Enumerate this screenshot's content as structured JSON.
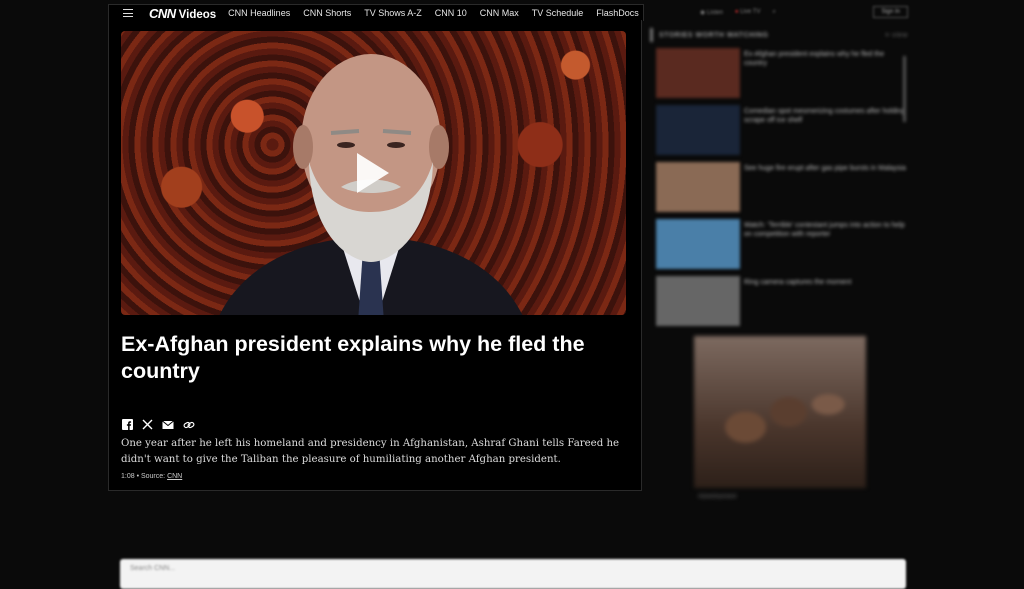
{
  "nav": {
    "logo": "CNN",
    "section": "Videos",
    "links": [
      "CNN Headlines",
      "CNN Shorts",
      "TV Shows A-Z",
      "CNN 10",
      "CNN Max",
      "TV Schedule",
      "FlashDocs"
    ],
    "right": {
      "listen": "Listen",
      "live_tv": "Live TV",
      "sign_in": "Sign In"
    }
  },
  "video": {
    "headline": "Ex-Afghan president explains why he fled the country",
    "description": "One year after he left his homeland and presidency in Afghanistan, Ashraf Ghani tells Fareed he didn't want to give the Taliban the pleasure of humiliating another Afghan president.",
    "duration": "1:08",
    "source_prefix": "• Source:",
    "source": "CNN",
    "share_icons": [
      "facebook-icon",
      "x-icon",
      "email-icon",
      "link-icon"
    ]
  },
  "sidebar": {
    "heading": "STORIES WORTH WATCHING",
    "more": "≡ view",
    "items": [
      {
        "title": "Ex-Afghan president explains why he fled the country",
        "thumb": "#5a2a20"
      },
      {
        "title": "Comedian spot mesmerizing costumes after holding scrape off ice shelf",
        "thumb": "#1a2538"
      },
      {
        "title": "See huge fire erupt after gas pipe bursts in Malaysia",
        "thumb": "#8a6a55"
      },
      {
        "title": "Watch: 'Terrible' contestant jumps into action to help on competition with reporter",
        "thumb": "#4a7fa8"
      },
      {
        "title": "Ring camera captures the moment",
        "thumb": "#666666"
      }
    ]
  },
  "ad": {
    "label": "Advertisement"
  },
  "bottom": {
    "placeholder": "Search CNN..."
  }
}
